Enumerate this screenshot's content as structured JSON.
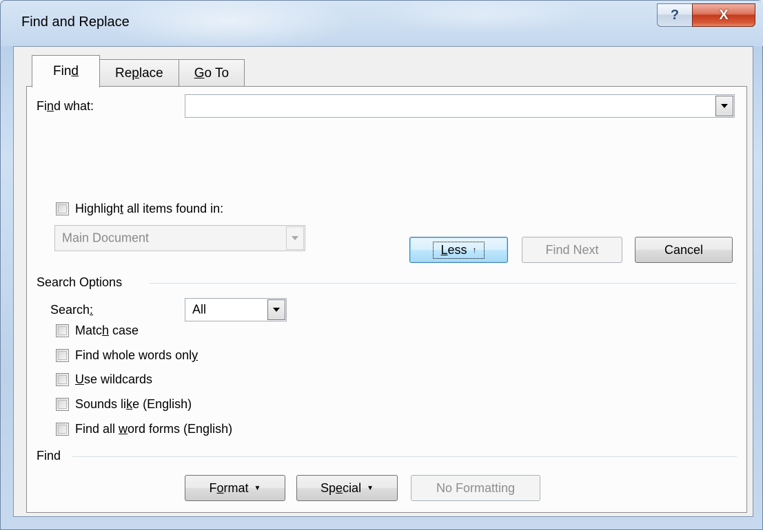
{
  "window": {
    "title": "Find and Replace",
    "help_glyph": "?",
    "close_glyph": "X"
  },
  "tabs": [
    {
      "label_pre": "Fin",
      "label_u": "d",
      "label_post": "",
      "active": true
    },
    {
      "label_pre": "Re",
      "label_u": "p",
      "label_post": "lace",
      "active": false
    },
    {
      "label_pre": "",
      "label_u": "G",
      "label_post": "o To",
      "active": false
    }
  ],
  "find_what": {
    "label_pre": "Fi",
    "label_u": "n",
    "label_post": "d what:",
    "value": ""
  },
  "highlight": {
    "label_pre": "Highligh",
    "label_u": "t",
    "label_post": " all items found in:",
    "checked": false,
    "scope_value": "Main Document"
  },
  "buttons": {
    "less_u": "L",
    "less_rest": "ess",
    "less_icon": "↑",
    "find_next": "Find Next",
    "cancel": "Cancel"
  },
  "search_options": {
    "heading": "Search Options",
    "search_label_pre": "Search",
    "search_label_u": ":",
    "search_value": "All",
    "options": [
      {
        "pre": "Matc",
        "u": "h",
        "post": " case",
        "checked": false
      },
      {
        "pre": "Find whole words onl",
        "u": "y",
        "post": "",
        "checked": false
      },
      {
        "pre": "",
        "u": "U",
        "post": "se wildcards",
        "checked": false
      },
      {
        "pre": "Sounds li",
        "u": "k",
        "post": "e (English)",
        "checked": false
      },
      {
        "pre": "Find all ",
        "u": "w",
        "post": "ord forms (English)",
        "checked": false
      }
    ]
  },
  "find_section": {
    "heading": "Find",
    "format_pre": "F",
    "format_u": "o",
    "format_post": "rmat",
    "special_pre": "Sp",
    "special_u": "e",
    "special_post": "cial",
    "no_formatting": "No Formatting",
    "dropdown_glyph": "▼"
  }
}
